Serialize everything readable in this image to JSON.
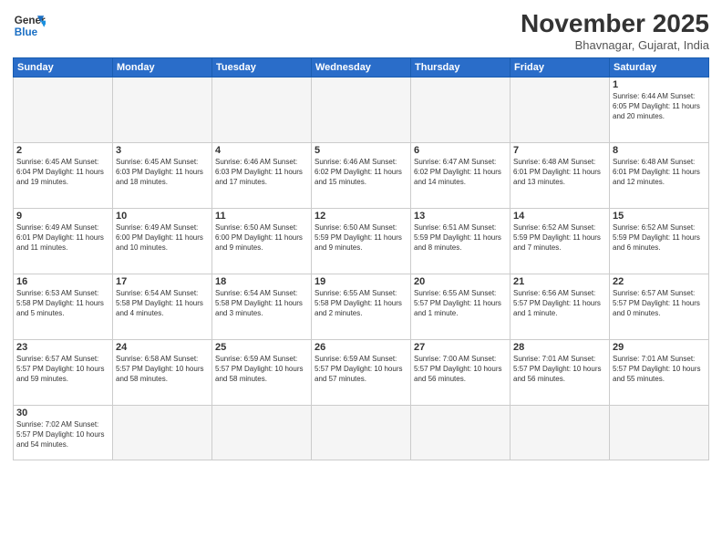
{
  "header": {
    "logo_general": "General",
    "logo_blue": "Blue",
    "month_title": "November 2025",
    "location": "Bhavnagar, Gujarat, India"
  },
  "weekdays": [
    "Sunday",
    "Monday",
    "Tuesday",
    "Wednesday",
    "Thursday",
    "Friday",
    "Saturday"
  ],
  "weeks": [
    [
      {
        "num": "",
        "info": "",
        "empty": true
      },
      {
        "num": "",
        "info": "",
        "empty": true
      },
      {
        "num": "",
        "info": "",
        "empty": true
      },
      {
        "num": "",
        "info": "",
        "empty": true
      },
      {
        "num": "",
        "info": "",
        "empty": true
      },
      {
        "num": "",
        "info": "",
        "empty": true
      },
      {
        "num": "1",
        "info": "Sunrise: 6:44 AM\nSunset: 6:05 PM\nDaylight: 11 hours\nand 20 minutes."
      }
    ],
    [
      {
        "num": "2",
        "info": "Sunrise: 6:45 AM\nSunset: 6:04 PM\nDaylight: 11 hours\nand 19 minutes."
      },
      {
        "num": "3",
        "info": "Sunrise: 6:45 AM\nSunset: 6:03 PM\nDaylight: 11 hours\nand 18 minutes."
      },
      {
        "num": "4",
        "info": "Sunrise: 6:46 AM\nSunset: 6:03 PM\nDaylight: 11 hours\nand 17 minutes."
      },
      {
        "num": "5",
        "info": "Sunrise: 6:46 AM\nSunset: 6:02 PM\nDaylight: 11 hours\nand 15 minutes."
      },
      {
        "num": "6",
        "info": "Sunrise: 6:47 AM\nSunset: 6:02 PM\nDaylight: 11 hours\nand 14 minutes."
      },
      {
        "num": "7",
        "info": "Sunrise: 6:48 AM\nSunset: 6:01 PM\nDaylight: 11 hours\nand 13 minutes."
      },
      {
        "num": "8",
        "info": "Sunrise: 6:48 AM\nSunset: 6:01 PM\nDaylight: 11 hours\nand 12 minutes."
      }
    ],
    [
      {
        "num": "9",
        "info": "Sunrise: 6:49 AM\nSunset: 6:01 PM\nDaylight: 11 hours\nand 11 minutes."
      },
      {
        "num": "10",
        "info": "Sunrise: 6:49 AM\nSunset: 6:00 PM\nDaylight: 11 hours\nand 10 minutes."
      },
      {
        "num": "11",
        "info": "Sunrise: 6:50 AM\nSunset: 6:00 PM\nDaylight: 11 hours\nand 9 minutes."
      },
      {
        "num": "12",
        "info": "Sunrise: 6:50 AM\nSunset: 5:59 PM\nDaylight: 11 hours\nand 9 minutes."
      },
      {
        "num": "13",
        "info": "Sunrise: 6:51 AM\nSunset: 5:59 PM\nDaylight: 11 hours\nand 8 minutes."
      },
      {
        "num": "14",
        "info": "Sunrise: 6:52 AM\nSunset: 5:59 PM\nDaylight: 11 hours\nand 7 minutes."
      },
      {
        "num": "15",
        "info": "Sunrise: 6:52 AM\nSunset: 5:59 PM\nDaylight: 11 hours\nand 6 minutes."
      }
    ],
    [
      {
        "num": "16",
        "info": "Sunrise: 6:53 AM\nSunset: 5:58 PM\nDaylight: 11 hours\nand 5 minutes."
      },
      {
        "num": "17",
        "info": "Sunrise: 6:54 AM\nSunset: 5:58 PM\nDaylight: 11 hours\nand 4 minutes."
      },
      {
        "num": "18",
        "info": "Sunrise: 6:54 AM\nSunset: 5:58 PM\nDaylight: 11 hours\nand 3 minutes."
      },
      {
        "num": "19",
        "info": "Sunrise: 6:55 AM\nSunset: 5:58 PM\nDaylight: 11 hours\nand 2 minutes."
      },
      {
        "num": "20",
        "info": "Sunrise: 6:55 AM\nSunset: 5:57 PM\nDaylight: 11 hours\nand 1 minute."
      },
      {
        "num": "21",
        "info": "Sunrise: 6:56 AM\nSunset: 5:57 PM\nDaylight: 11 hours\nand 1 minute."
      },
      {
        "num": "22",
        "info": "Sunrise: 6:57 AM\nSunset: 5:57 PM\nDaylight: 11 hours\nand 0 minutes."
      }
    ],
    [
      {
        "num": "23",
        "info": "Sunrise: 6:57 AM\nSunset: 5:57 PM\nDaylight: 10 hours\nand 59 minutes."
      },
      {
        "num": "24",
        "info": "Sunrise: 6:58 AM\nSunset: 5:57 PM\nDaylight: 10 hours\nand 58 minutes."
      },
      {
        "num": "25",
        "info": "Sunrise: 6:59 AM\nSunset: 5:57 PM\nDaylight: 10 hours\nand 58 minutes."
      },
      {
        "num": "26",
        "info": "Sunrise: 6:59 AM\nSunset: 5:57 PM\nDaylight: 10 hours\nand 57 minutes."
      },
      {
        "num": "27",
        "info": "Sunrise: 7:00 AM\nSunset: 5:57 PM\nDaylight: 10 hours\nand 56 minutes."
      },
      {
        "num": "28",
        "info": "Sunrise: 7:01 AM\nSunset: 5:57 PM\nDaylight: 10 hours\nand 56 minutes."
      },
      {
        "num": "29",
        "info": "Sunrise: 7:01 AM\nSunset: 5:57 PM\nDaylight: 10 hours\nand 55 minutes."
      }
    ],
    [
      {
        "num": "30",
        "info": "Sunrise: 7:02 AM\nSunset: 5:57 PM\nDaylight: 10 hours\nand 54 minutes.",
        "last": true
      },
      {
        "num": "",
        "info": "",
        "empty": true,
        "last": true
      },
      {
        "num": "",
        "info": "",
        "empty": true,
        "last": true
      },
      {
        "num": "",
        "info": "",
        "empty": true,
        "last": true
      },
      {
        "num": "",
        "info": "",
        "empty": true,
        "last": true
      },
      {
        "num": "",
        "info": "",
        "empty": true,
        "last": true
      },
      {
        "num": "",
        "info": "",
        "empty": true,
        "last": true
      }
    ]
  ]
}
